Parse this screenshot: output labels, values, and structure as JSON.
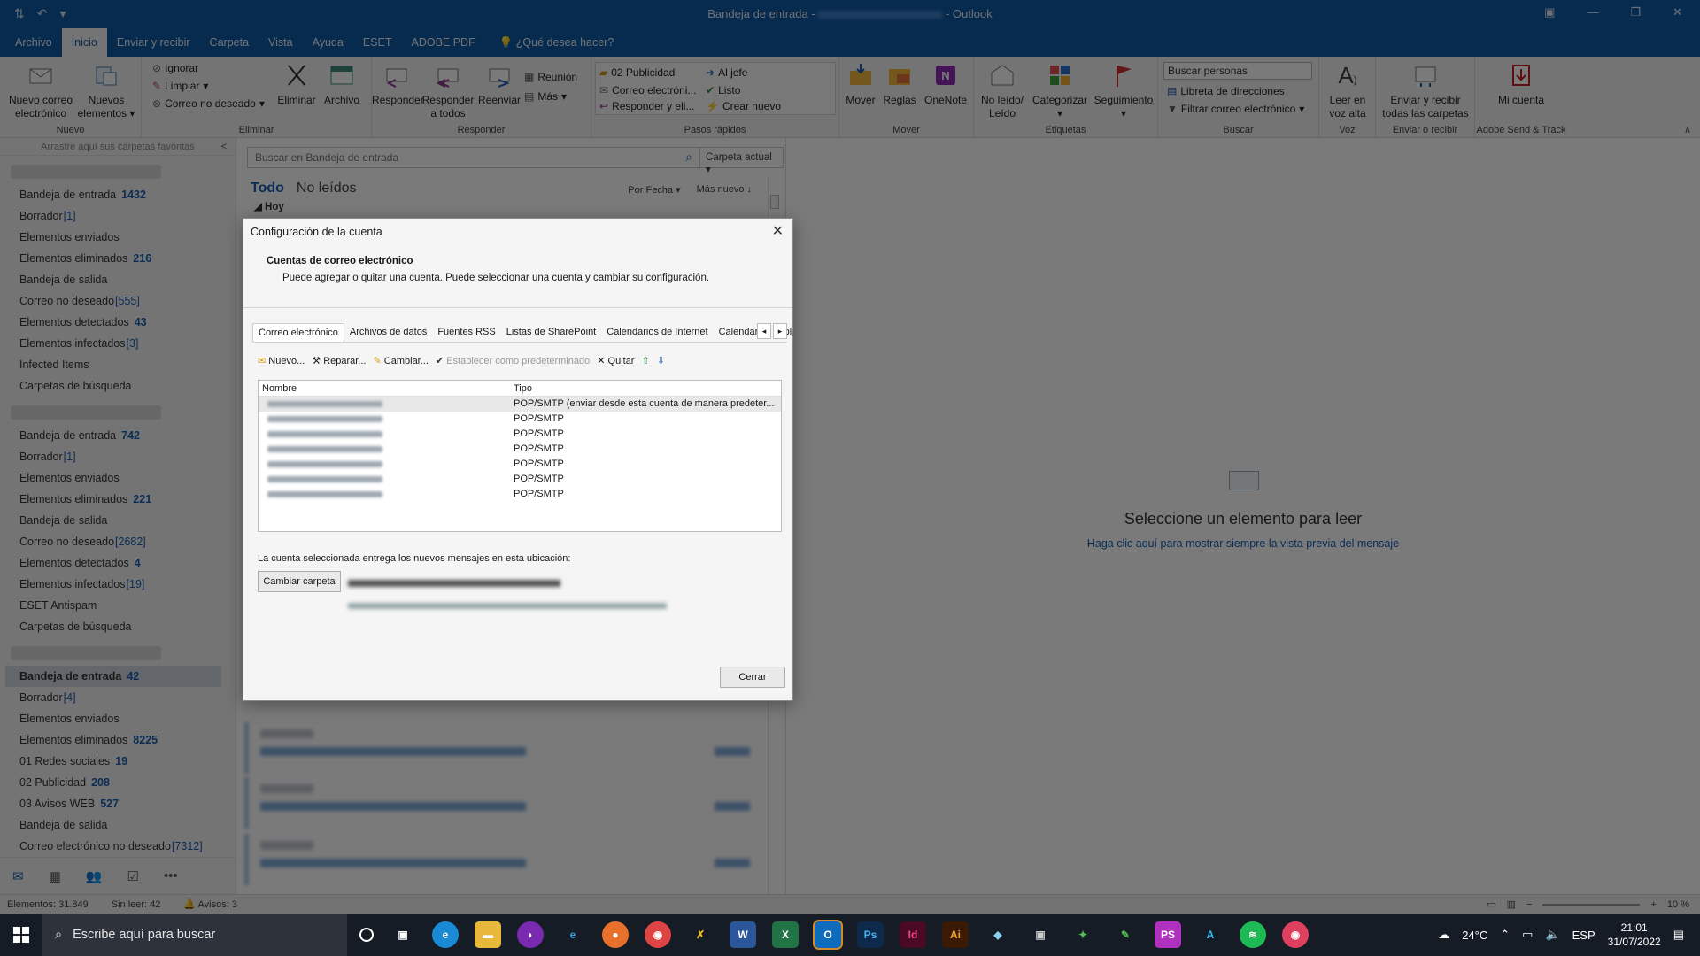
{
  "window": {
    "title": "Bandeja de entrada",
    "sep": "-",
    "app": "Outlook"
  },
  "menu": {
    "tabs": [
      "Archivo",
      "Inicio",
      "Enviar y recibir",
      "Carpeta",
      "Vista",
      "Ayuda",
      "ESET",
      "ADOBE PDF"
    ],
    "tell_me": "¿Qué desea hacer?"
  },
  "ribbon": {
    "nuevo_correo": "Nuevo correo electrónico",
    "nuevos_elementos": "Nuevos elementos",
    "grp_nuevo": "Nuevo",
    "ignorar": "Ignorar",
    "limpiar": "Limpiar",
    "correo_no_deseado": "Correo no deseado",
    "eliminar": "Eliminar",
    "archivo": "Archivo",
    "grp_eliminar": "Eliminar",
    "responder": "Responder",
    "responder_todos": "Responder a todos",
    "reenviar": "Reenviar",
    "reunion": "Reunión",
    "mas": "Más",
    "grp_responder": "Responder",
    "qs": [
      "02 Publicidad",
      "Al jefe",
      "Correo electróni...",
      "Listo",
      "Responder y eli...",
      "Crear nuevo"
    ],
    "grp_pasos": "Pasos rápidos",
    "mover": "Mover",
    "reglas": "Reglas",
    "onenote": "OneNote",
    "grp_mover": "Mover",
    "no_leido": "No leído/ Leído",
    "categorizar": "Categorizar",
    "seguimiento": "Seguimiento",
    "grp_etiquetas": "Etiquetas",
    "buscar_personas": "Buscar personas",
    "libreta": "Libreta de direcciones",
    "filtrar": "Filtrar correo electrónico",
    "grp_buscar": "Buscar",
    "leer_voz": "Leer en voz alta",
    "grp_voz": "Voz",
    "enviar_recibir": "Enviar y recibir todas las carpetas",
    "grp_enviar": "Enviar o recibir",
    "mi_cuenta": "Mi cuenta",
    "grp_adobe": "Adobe Send & Track"
  },
  "folders": {
    "fav_hint": "Arrastre aquí sus carpetas favoritas",
    "acc1": [
      {
        "name": "Bandeja de entrada",
        "count": "1432"
      },
      {
        "name": "Borrador",
        "countb": "[1]"
      },
      {
        "name": "Elementos enviados"
      },
      {
        "name": "Elementos eliminados",
        "count": "216"
      },
      {
        "name": "Bandeja de salida"
      },
      {
        "name": "Correo no deseado",
        "countb": "[555]"
      },
      {
        "name": "Elementos detectados",
        "count": "43"
      },
      {
        "name": "Elementos infectados",
        "countb": "[3]"
      },
      {
        "name": "Infected Items"
      },
      {
        "name": "Carpetas de búsqueda"
      }
    ],
    "acc2": [
      {
        "name": "Bandeja de entrada",
        "count": "742"
      },
      {
        "name": "Borrador",
        "countb": "[1]"
      },
      {
        "name": "Elementos enviados"
      },
      {
        "name": "Elementos eliminados",
        "count": "221"
      },
      {
        "name": "Bandeja de salida"
      },
      {
        "name": "Correo no deseado",
        "countb": "[2682]"
      },
      {
        "name": "Elementos detectados",
        "count": "4"
      },
      {
        "name": "Elementos infectados",
        "countb": "[19]"
      },
      {
        "name": "ESET Antispam"
      },
      {
        "name": "Carpetas de búsqueda"
      }
    ],
    "acc3": [
      {
        "name": "Bandeja de entrada",
        "count": "42",
        "selected": true
      },
      {
        "name": "Borrador",
        "countb": "[4]"
      },
      {
        "name": "Elementos enviados"
      },
      {
        "name": "Elementos eliminados",
        "count": "8225"
      },
      {
        "name": "01 Redes sociales",
        "count": "19"
      },
      {
        "name": "02 Publicidad",
        "count": "208"
      },
      {
        "name": "03 Avisos WEB",
        "count": "527"
      },
      {
        "name": "Bandeja de salida"
      },
      {
        "name": "Correo electrónico no deseado",
        "countb": "[7312]"
      }
    ]
  },
  "list": {
    "search_placeholder": "Buscar en Bandeja de entrada",
    "scope": "Carpeta actual",
    "tab_all": "Todo",
    "tab_unread": "No leídos",
    "sort_by": "Por Fecha",
    "order": "Más nuevo",
    "group": "Hoy"
  },
  "reading": {
    "title": "Seleccione un elemento para leer",
    "link": "Haga clic aquí para mostrar siempre la vista previa del mensaje"
  },
  "status": {
    "items": "Elementos: 31.849",
    "unread": "Sin leer: 42",
    "reminders": "Avisos: 3",
    "zoom": "10 %"
  },
  "dialog": {
    "title": "Configuración de la cuenta",
    "header": "Cuentas de correo electrónico",
    "desc": "Puede agregar o quitar una cuenta. Puede seleccionar una cuenta y cambiar su configuración.",
    "tabs": [
      "Correo electrónico",
      "Archivos de datos",
      "Fuentes RSS",
      "Listas de SharePoint",
      "Calendarios de Internet",
      "Calendarios publ"
    ],
    "tools": {
      "nuevo": "Nuevo...",
      "reparar": "Reparar...",
      "cambiar": "Cambiar...",
      "predeterminado": "Establecer como predeterminado",
      "quitar": "Quitar"
    },
    "col_nombre": "Nombre",
    "col_tipo": "Tipo",
    "rows": [
      "POP/SMTP (enviar desde esta cuenta de manera predeter...",
      "POP/SMTP",
      "POP/SMTP",
      "POP/SMTP",
      "POP/SMTP",
      "POP/SMTP",
      "POP/SMTP"
    ],
    "deliver": "La cuenta seleccionada entrega los nuevos mensajes en esta ubicación:",
    "change_folder": "Cambiar carpeta",
    "close": "Cerrar"
  },
  "taskbar": {
    "search": "Escribe aquí para buscar",
    "temp": "24°C",
    "lang": "ESP",
    "time": "21:01",
    "date": "31/07/2022"
  }
}
